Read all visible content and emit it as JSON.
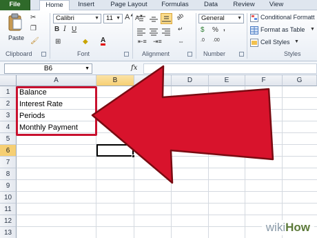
{
  "tabs": [
    "File",
    "Home",
    "Insert",
    "Page Layout",
    "Formulas",
    "Data",
    "Review",
    "View"
  ],
  "clipboard": {
    "paste_label": "Paste",
    "group_label": "Clipboard"
  },
  "font": {
    "name": "Calibri",
    "size": "11",
    "group_label": "Font"
  },
  "alignment": {
    "group_label": "Alignment"
  },
  "number": {
    "format": "General",
    "group_label": "Number",
    "currency": "$",
    "percent": "%",
    "comma": ",",
    "dec_inc": ".0",
    "dec_dec": ".00"
  },
  "styles": {
    "conditional": "Conditional Formatt",
    "format_table": "Format as Table",
    "cell_styles": "Cell Styles",
    "group_label": "Styles"
  },
  "formula_bar": {
    "name_box": "B6",
    "fx": "fx",
    "value": ""
  },
  "columns": [
    "A",
    "B",
    "C",
    "D",
    "E",
    "F",
    "G"
  ],
  "selected_column": "B",
  "rows": [
    "1",
    "2",
    "3",
    "4",
    "5",
    "6",
    "7",
    "8",
    "9",
    "10",
    "11",
    "12",
    "13"
  ],
  "selected_row": "6",
  "cells": {
    "A1": "Balance",
    "A2": "Interest Rate",
    "A3": "Periods",
    "A4": "Monthly Payment"
  },
  "watermark": {
    "wiki": "wiki",
    "how": "How"
  },
  "colors": {
    "highlight": "#c8102e",
    "file_tab": "#2f6a2a",
    "selection": "#f6cf73"
  }
}
